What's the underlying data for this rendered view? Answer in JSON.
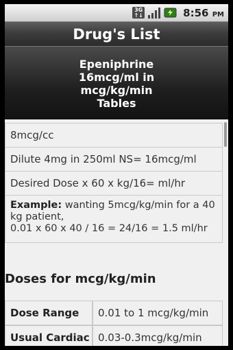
{
  "status_bar": {
    "network_label_top": "3G",
    "network_label_bottom": "↑↓",
    "time": "8:56",
    "ampm": "PM"
  },
  "app": {
    "title": "Drug's List"
  },
  "header": {
    "lines": [
      "Epeniphrine",
      "16mcg/ml in",
      "mcg/kg/min",
      "Tables"
    ]
  },
  "info": {
    "concentration": "8mcg/cc",
    "dilution": "Dilute 4mg in 250ml NS= 16mcg/ml",
    "formula": "Desired Dose x 60 x kg/16= ml/hr",
    "example_label": "Example:",
    "example_text": " wanting 5mcg/kg/min for a 40 kg patient,",
    "example_calc": "0.01 x 60 x 40 / 16 = 24/16 = 1.5 ml/hr"
  },
  "doses": {
    "section_title": "Doses for mcg/kg/min",
    "rows": [
      {
        "label": "Dose Range",
        "value": "0.01 to 1 mcg/kg/min"
      },
      {
        "label": "Usual Cardiac",
        "value": "0.03-0.3mcg/kg/min"
      }
    ]
  }
}
